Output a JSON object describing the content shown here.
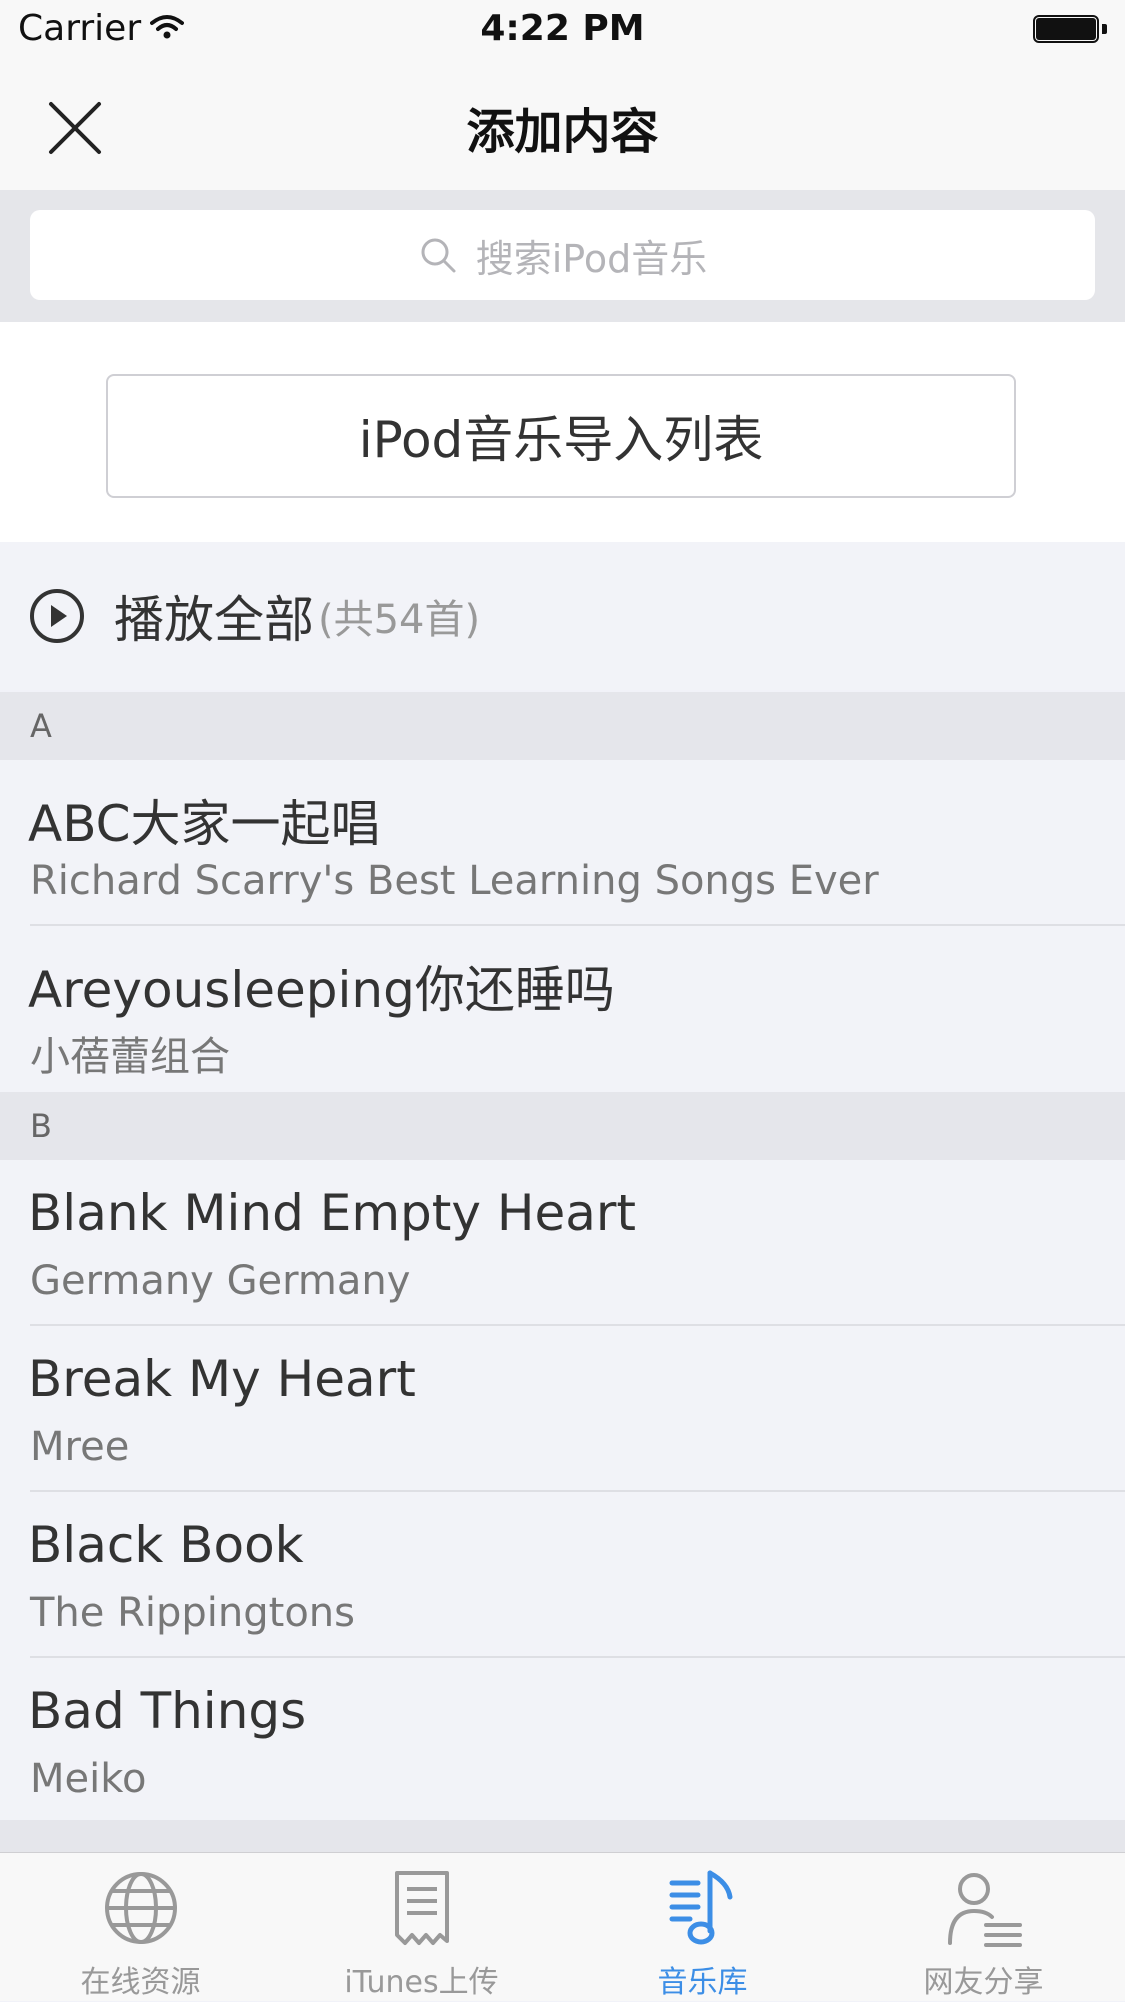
{
  "status_bar": {
    "carrier": "Carrier",
    "time": "4:22 PM"
  },
  "nav": {
    "title": "添加内容"
  },
  "search": {
    "placeholder": "搜索iPod音乐"
  },
  "import_button": {
    "label": "iPod音乐导入列表"
  },
  "play_all": {
    "label": "播放全部",
    "count": "(共54首)"
  },
  "sections": [
    {
      "letter": "A",
      "items": [
        {
          "title": "ABC大家一起唱",
          "subtitle": "Richard Scarry's Best Learning Songs Ever"
        },
        {
          "title": "Areyousleeping你还睡吗",
          "subtitle": "小蓓蕾组合"
        }
      ]
    },
    {
      "letter": "B",
      "items": [
        {
          "title": "Blank Mind Empty Heart",
          "subtitle": "Germany Germany"
        },
        {
          "title": "Break My Heart",
          "subtitle": "Mree"
        },
        {
          "title": "Black Book",
          "subtitle": "The Rippingtons"
        },
        {
          "title": "Bad Things",
          "subtitle": "Meiko"
        }
      ]
    }
  ],
  "tabs": [
    {
      "label": "在线资源",
      "icon": "globe-icon",
      "active": false
    },
    {
      "label": "iTunes上传",
      "icon": "receipt-icon",
      "active": false
    },
    {
      "label": "音乐库",
      "icon": "music-list-icon",
      "active": true
    },
    {
      "label": "网友分享",
      "icon": "user-list-icon",
      "active": false
    }
  ],
  "colors": {
    "accent": "#3c8ee6",
    "tab_inactive": "#999999"
  }
}
